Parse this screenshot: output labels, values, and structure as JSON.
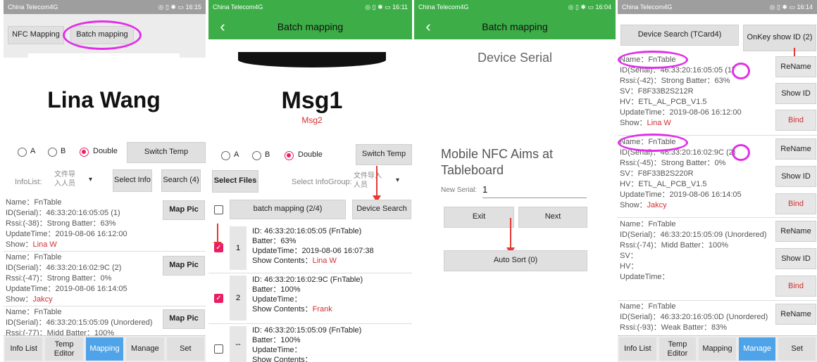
{
  "status": {
    "carrier": "China Telecom4G",
    "p1_time": "16:15",
    "p2_time": "16:11",
    "p3_time": "16:04",
    "p4_time": "16:14",
    "indicators": "◎ ▯ ✱ ▭"
  },
  "p1": {
    "tab_nfc": "NFC Mapping",
    "tab_batch": "Batch mapping",
    "preview_name": "Lina Wang",
    "radio_a": "A",
    "radio_b": "B",
    "radio_double": "Double",
    "switch_temp": "Switch Temp",
    "infolist_label": "InfoList:",
    "infolist_value": "文件导入人员",
    "select_info": "Select Info",
    "search": "Search (4)",
    "map_pic": "Map Pic",
    "items": [
      {
        "name": "Name：FnTable",
        "id": "ID(Serial)：46:33:20:16:05:05  (1)",
        "rssi": "Rssi:(-38)：Strong   Batter：63%",
        "update": "UpdateTime：2019-08-06 16:12:00",
        "show_label": "Show：",
        "show_value": "Lina W"
      },
      {
        "name": "Name：FnTable",
        "id": "ID(Serial)：46:33:20:16:02:9C  (2)",
        "rssi": "Rssi:(-47)：Strong   Batter：0%",
        "update": "UpdateTime：2019-08-06 16:14:05",
        "show_label": "Show：",
        "show_value": "Jakcy"
      },
      {
        "name": "Name：FnTable",
        "id": "ID(Serial)：46:33:20:15:05:09  (Unordered)",
        "rssi": "Rssi:(-77)：Midd   Batter：100%"
      }
    ],
    "nav": [
      "Info List",
      "Temp Editor",
      "Mapping",
      "Manage",
      "Set"
    ]
  },
  "p2": {
    "title": "Batch mapping",
    "preview_msg1": "Msg1",
    "preview_msg2": "Msg2",
    "radio_a": "A",
    "radio_b": "B",
    "radio_double": "Double",
    "switch_temp": "Switch Temp",
    "select_files": "Select Files",
    "select_infogroup": "Select InfoGroup:",
    "infogroup_value": "文件导入人员",
    "batch_mapping": "batch mapping (2/4)",
    "device_search": "Device Search",
    "rows": [
      {
        "num": "1",
        "checked": true,
        "id": "ID: 46:33:20:16:05:05 (FnTable)",
        "batter": "Batter：63%",
        "update": "UpdateTime：2019-08-06 16:07:38",
        "show_label": "Show Contents：",
        "show_value": "Lina W"
      },
      {
        "num": "2",
        "checked": true,
        "id": "ID: 46:33:20:16:02:9C (FnTable)",
        "batter": "Batter：100%",
        "update": "UpdateTime：",
        "show_label": "Show Contents：",
        "show_value": "Frank"
      },
      {
        "num": "--",
        "checked": false,
        "id": "ID: 46:33:20:15:05:09 (FnTable)",
        "batter": "Batter：100%",
        "update": "UpdateTime：",
        "show_label": "Show Contents：",
        "show_value": ""
      }
    ]
  },
  "p3": {
    "title": "Batch mapping",
    "heading": "Device Serial",
    "aims_text": "Mobile NFC Aims at Tableboard",
    "new_serial_label": "New Serial:",
    "new_serial_value": "1",
    "exit": "Exit",
    "next": "Next",
    "auto_sort": "Auto Sort (0)"
  },
  "p4": {
    "device_search": "Device Search (TCard4)",
    "onkey_show": "OnKey show ID (2)",
    "rename": "ReName",
    "show_id": "Show ID",
    "bind": "Bind",
    "items": [
      {
        "name": "Name：FnTable",
        "id": "ID(Serial)：46:33:20:16:05:05  (1)",
        "rssi": "Rssi:(-42)：Strong   Batter：63%",
        "sv": "SV：F8F33B2S212R",
        "hv": "HV：ETL_AL_PCB_V1.5",
        "update": "UpdateTime：2019-08-06 16:12:00",
        "show_label": "Show：",
        "show_value": "Lina W"
      },
      {
        "name": "Name：FnTable",
        "id": "ID(Serial)：46:33:20:16:02:9C  (2)",
        "rssi": "Rssi:(-45)：Strong   Batter：0%",
        "sv": "SV：F8F33B2S220R",
        "hv": "HV：ETL_AL_PCB_V1.5",
        "update": "UpdateTime：2019-08-06 16:14:05",
        "show_label": "Show：",
        "show_value": "Jakcy"
      },
      {
        "name": "Name：FnTable",
        "id": "ID(Serial)：46:33:20:15:05:09  (Unordered)",
        "rssi": "Rssi:(-74)：Midd   Batter：100%",
        "sv": "SV：",
        "hv": "HV：",
        "update": "UpdateTime：",
        "show_label": "",
        "show_value": ""
      },
      {
        "name": "Name：FnTable",
        "id": "ID(Serial)：46:33:20:16:05:0D  (Unordered)",
        "rssi": "Rssi:(-93)：Weak   Batter：83%"
      }
    ],
    "nav": [
      "Info List",
      "Temp Editor",
      "Mapping",
      "Manage",
      "Set"
    ]
  }
}
